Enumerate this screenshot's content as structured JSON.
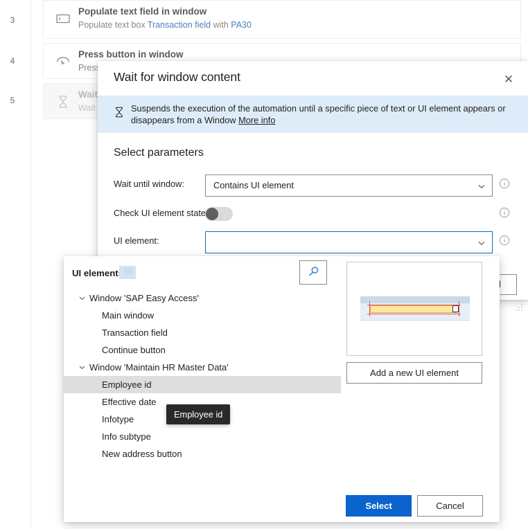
{
  "background_flow": {
    "rows": [
      {
        "number": "3",
        "title": "Populate text field in window",
        "sub_prefix": "Populate text box ",
        "sub_link1": "Transaction field",
        "sub_mid": " with ",
        "sub_link2": "PA30",
        "icon": "text-field-icon",
        "dim": false
      },
      {
        "number": "4",
        "title": "Press button in window",
        "sub_prefix": "Press",
        "sub_link1": "",
        "sub_mid": "",
        "sub_link2": "",
        "icon": "press-button-icon",
        "dim": false
      },
      {
        "number": "5",
        "title": "Wait",
        "sub_prefix": "Wait f",
        "sub_link1": "",
        "sub_mid": "",
        "sub_link2": "",
        "icon": "hourglass-icon",
        "dim": true
      }
    ]
  },
  "modal": {
    "title": "Wait for window content",
    "close_label": "✕",
    "banner": {
      "icon": "hourglass-icon",
      "text": "Suspends the execution of the automation until a specific piece of text or UI element appears or disappears from a Window ",
      "link": "More info"
    },
    "section_title": "Select parameters",
    "params": [
      {
        "label": "Wait until window:",
        "type": "combo",
        "value": "Contains UI element",
        "focused": false,
        "info": "info-icon"
      },
      {
        "label": "Check UI element state:",
        "type": "toggle",
        "value": "Off",
        "info": "info-icon"
      },
      {
        "label": "UI element:",
        "type": "combo",
        "value": "",
        "focused": true,
        "info": "info-icon"
      }
    ],
    "obscured_button_label": "Cancel",
    "resize_grip": "resize-grip-icon"
  },
  "picker": {
    "heading": "UI elements",
    "badge_count": "10",
    "spy_button_icon": "magnifier-icon",
    "tree": [
      {
        "label": "Window 'SAP Easy Access'",
        "level": 0,
        "expanded": true,
        "selected": false
      },
      {
        "label": "Main window",
        "level": 1,
        "expanded": false,
        "selected": false
      },
      {
        "label": "Transaction field",
        "level": 1,
        "expanded": false,
        "selected": false
      },
      {
        "label": "Continue button",
        "level": 1,
        "expanded": false,
        "selected": false
      },
      {
        "label": "Window 'Maintain HR Master Data'",
        "level": 0,
        "expanded": true,
        "selected": false
      },
      {
        "label": "Employee id",
        "level": 1,
        "expanded": false,
        "selected": true
      },
      {
        "label": "Effective date",
        "level": 1,
        "expanded": false,
        "selected": false
      },
      {
        "label": "Infotype",
        "level": 1,
        "expanded": false,
        "selected": false
      },
      {
        "label": "Info subtype",
        "level": 1,
        "expanded": false,
        "selected": false
      },
      {
        "label": "New address button",
        "level": 1,
        "expanded": false,
        "selected": false
      }
    ],
    "tooltip": "Employee id",
    "preview_alt": "ui-element-preview-thumbnail",
    "add_button": "Add a new UI element",
    "select_button": "Select",
    "cancel_button": "Cancel"
  },
  "colors": {
    "accent": "#0b63ce",
    "banner_bg": "#deecf9",
    "selected_row": "#dedede",
    "tooltip_bg": "#292929",
    "badge_bg": "#cfe4f7",
    "link": "#4a7ebb"
  }
}
